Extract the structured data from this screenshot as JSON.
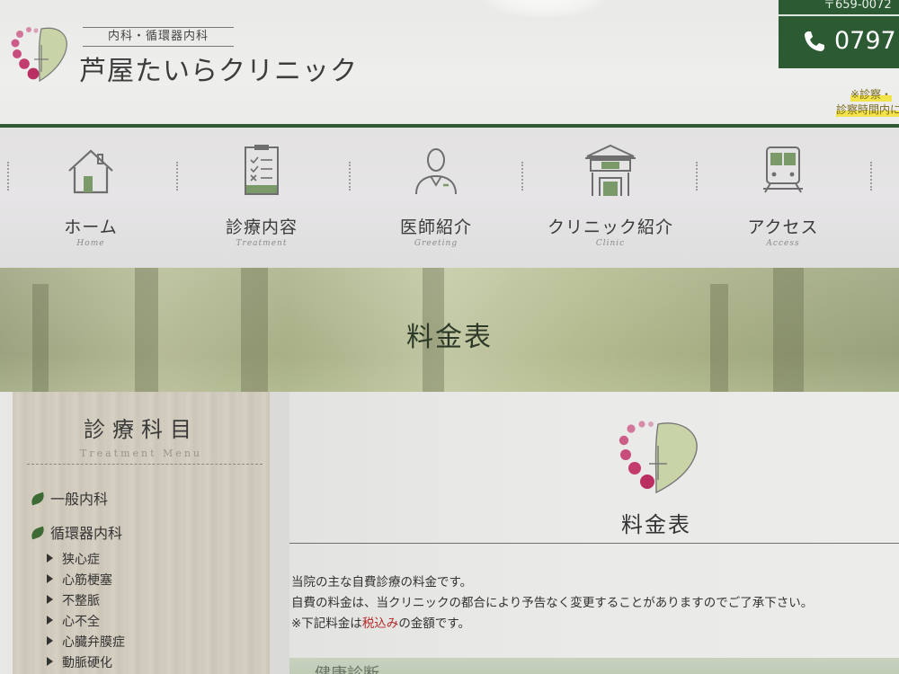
{
  "header": {
    "logo_department": "内科・循環器内科",
    "logo_name": "芦屋たいらクリニック",
    "tel_zip": "〒659-0072",
    "tel_number": "0797",
    "note_line1": "※診察・",
    "note_line2": "診察時間内に"
  },
  "nav": {
    "items": [
      {
        "label": "ホーム",
        "sub": "Home",
        "icon": "home-icon"
      },
      {
        "label": "診療内容",
        "sub": "Treatment",
        "icon": "clipboard-checklist-icon"
      },
      {
        "label": "医師紹介",
        "sub": "Greeting",
        "icon": "doctor-icon"
      },
      {
        "label": "クリニック紹介",
        "sub": "Clinic",
        "icon": "clinic-building-icon"
      },
      {
        "label": "アクセス",
        "sub": "Access",
        "icon": "train-icon"
      }
    ]
  },
  "hero": {
    "title": "料金表"
  },
  "sidebar": {
    "title": "診療科目",
    "subtitle": "Treatment Menu",
    "categories": [
      {
        "label": "一般内科"
      },
      {
        "label": "循環器内科"
      }
    ],
    "sub_items": [
      "狭心症",
      "心筋梗塞",
      "不整脈",
      "心不全",
      "心臓弁膜症",
      "動脈硬化"
    ]
  },
  "main": {
    "heading": "料金表",
    "line1": "当院の主な自費診療の料金です。",
    "line2": "自費の料金は、当クリニックの都合により予告なく変更することがありますのでご了承下さい。",
    "line3_prefix": "※下記料金は",
    "line3_highlight": "税込み",
    "line3_suffix": "の金額です。",
    "table_hint": "健康診断"
  },
  "colors": {
    "brand_green": "#2c5a33",
    "logo_pink": "#c23c6e",
    "logo_leaf": "#c9d3a8",
    "highlight_red": "#b52a2a",
    "note_yellow": "#f2e34a"
  }
}
